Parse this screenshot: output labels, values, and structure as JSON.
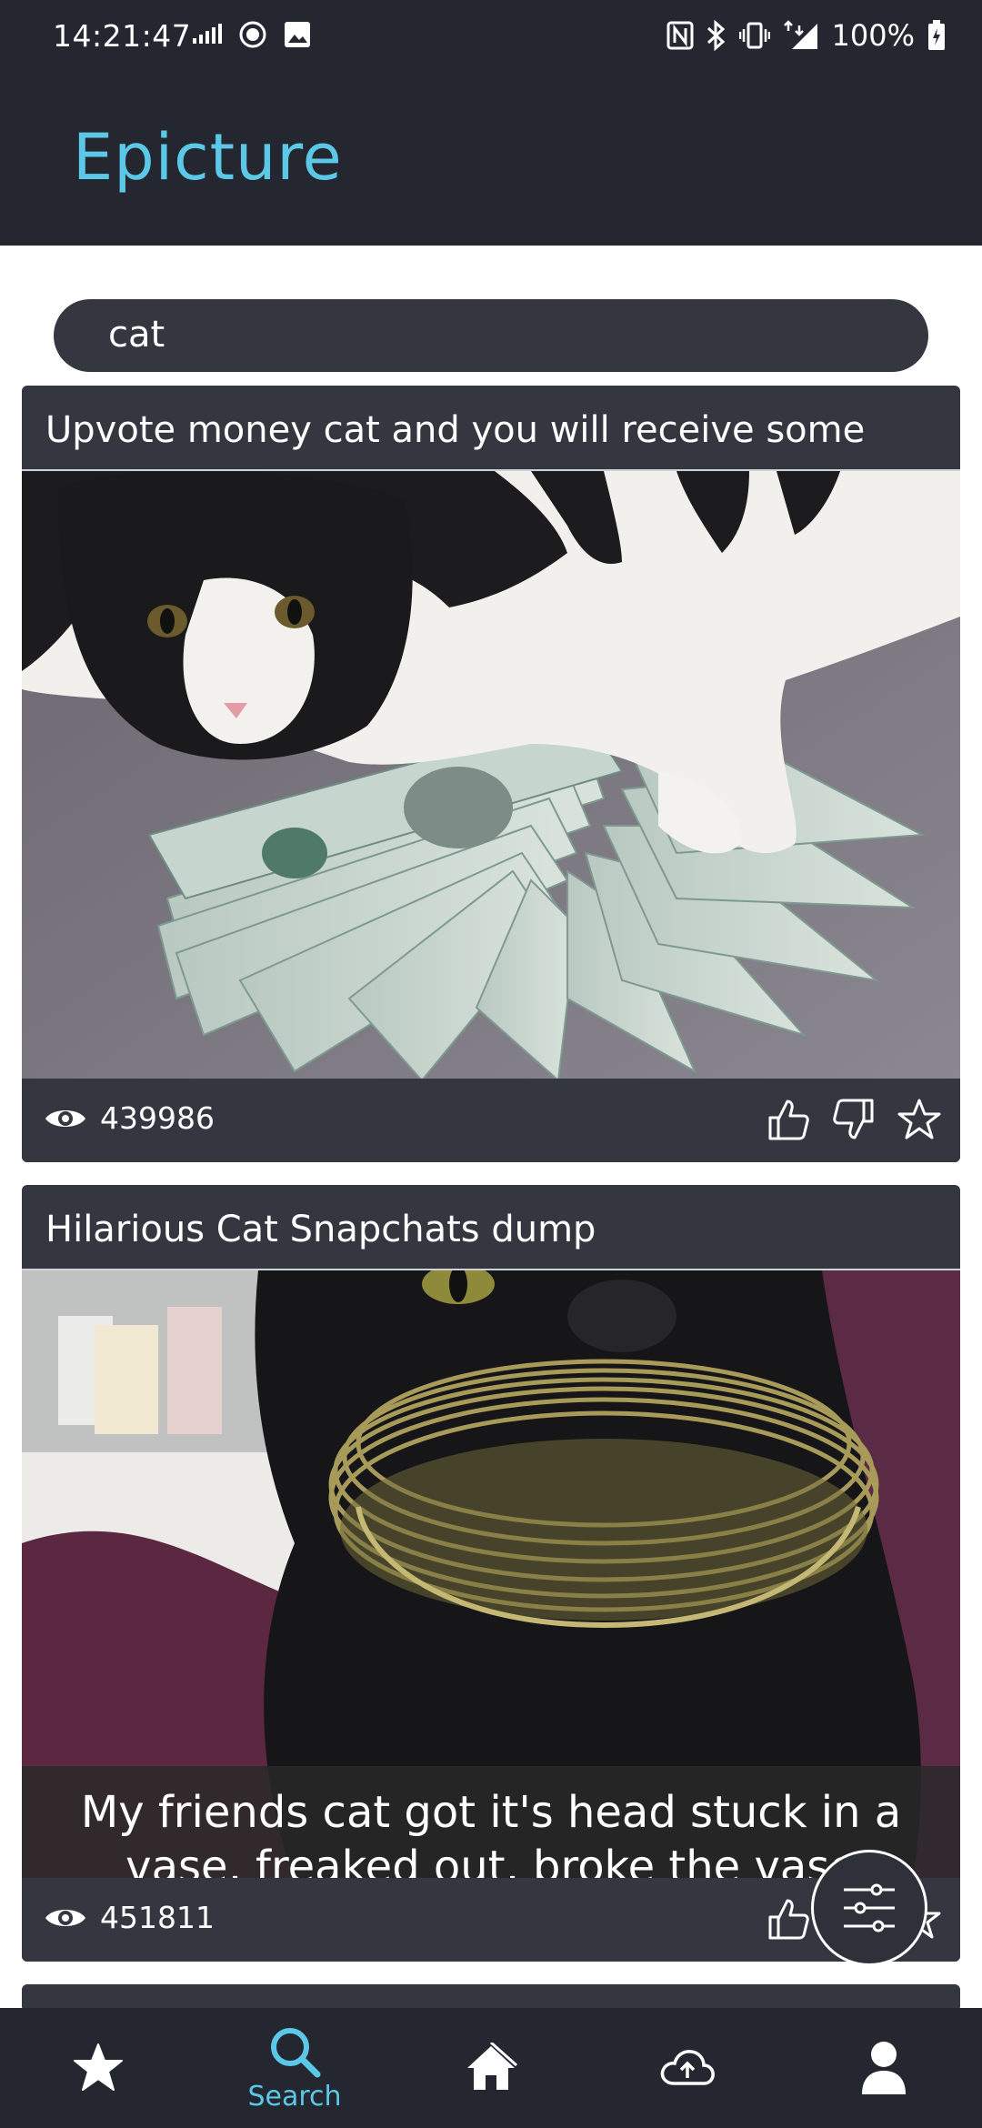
{
  "status_bar": {
    "time": "14:21:47",
    "battery": "100%",
    "network": "4G+"
  },
  "app": {
    "title": "Epicture"
  },
  "search": {
    "query": "cat"
  },
  "posts": [
    {
      "title": "Upvote money cat and you will receive some",
      "views": "439986"
    },
    {
      "title": "Hilarious Cat Snapchats dump",
      "views": "451811",
      "caption_line1": "My friends cat got it's head stuck in a",
      "caption_line2": "vase, freaked out, broke the vase"
    }
  ],
  "bottom_nav": {
    "items": [
      {
        "icon": "star-icon",
        "label": ""
      },
      {
        "icon": "search-icon",
        "label": "Search",
        "active": true
      },
      {
        "icon": "home-icon",
        "label": ""
      },
      {
        "icon": "cloud-upload-icon",
        "label": ""
      },
      {
        "icon": "person-icon",
        "label": ""
      }
    ]
  },
  "colors": {
    "accent": "#5bc8e8",
    "bar": "#242730",
    "card": "#343640"
  }
}
